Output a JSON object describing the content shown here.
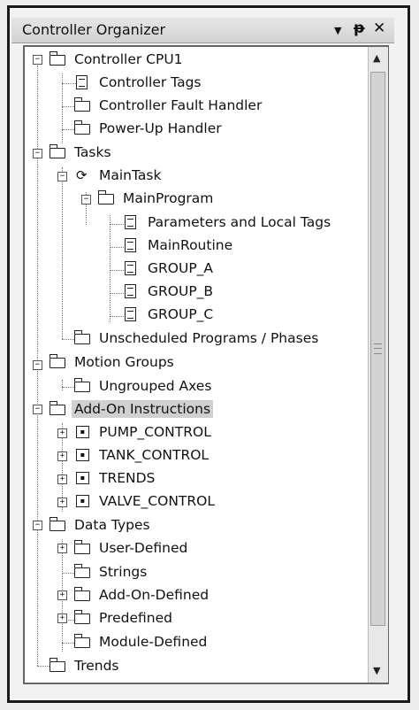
{
  "window": {
    "title": "Controller Organizer",
    "controls": {
      "dropdown": "▼",
      "pin": "ᵽ",
      "close": "✕"
    }
  },
  "tree": {
    "controller": "Controller CPU1",
    "controller_tags": "Controller Tags",
    "fault_handler": "Controller Fault Handler",
    "powerup_handler": "Power-Up Handler",
    "tasks": "Tasks",
    "main_task": "MainTask",
    "main_program": "MainProgram",
    "params_local_tags": "Parameters and Local Tags",
    "main_routine": "MainRoutine",
    "group_a": "GROUP_A",
    "group_b": "GROUP_B",
    "group_c": "GROUP_C",
    "unscheduled": "Unscheduled Programs / Phases",
    "motion_groups": "Motion Groups",
    "ungrouped_axes": "Ungrouped Axes",
    "aoi": "Add-On Instructions",
    "pump_control": "PUMP_CONTROL",
    "tank_control": "TANK_CONTROL",
    "trends_aoi": "TRENDS",
    "valve_control": "VALVE_CONTROL",
    "data_types": "Data Types",
    "user_defined": "User-Defined",
    "strings": "Strings",
    "aoi_defined": "Add-On-Defined",
    "predefined": "Predefined",
    "module_defined": "Module-Defined",
    "trends": "Trends"
  },
  "selected_item": "Add-On Instructions"
}
